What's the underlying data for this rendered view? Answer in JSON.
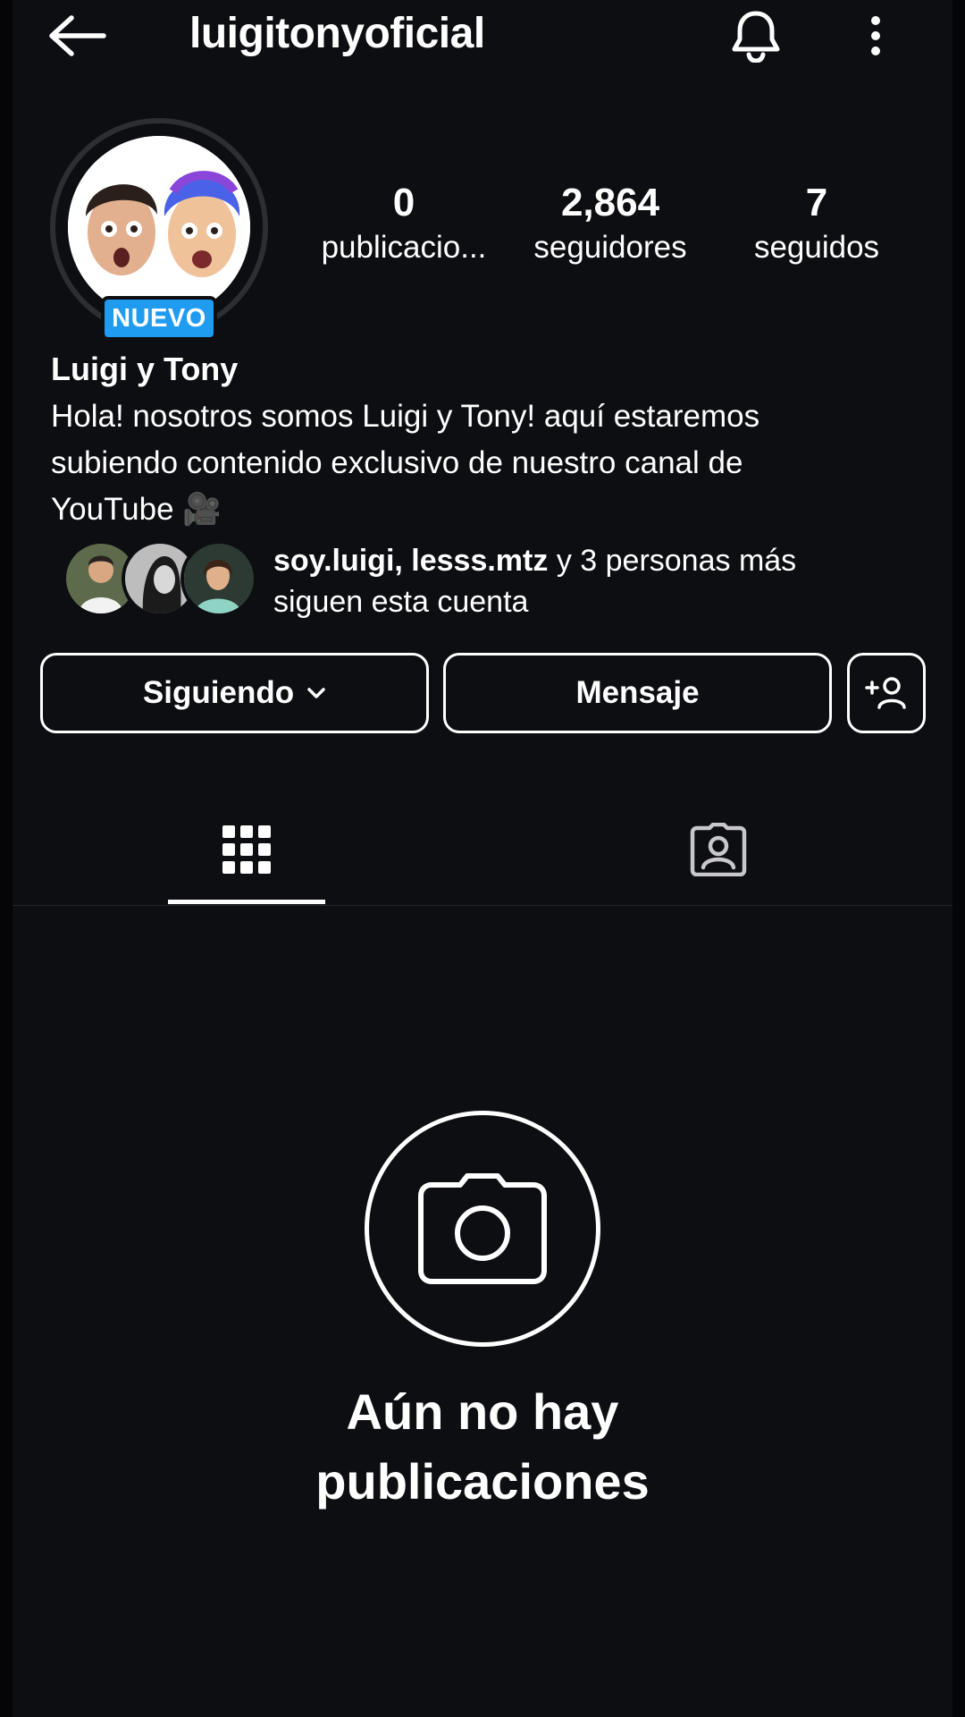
{
  "header": {
    "username": "luigitonyoficial",
    "back_icon": "arrow-left-icon",
    "notifications_icon": "bell-icon",
    "more_icon": "more-vertical-icon"
  },
  "profile": {
    "badge": "NUEVO",
    "display_name": "Luigi y Tony",
    "bio_lines": [
      "Hola! nosotros somos Luigi y Tony! aquí estaremos",
      "subiendo contenido exclusivo de nuestro canal de",
      "YouTube 🎥"
    ]
  },
  "stats": {
    "posts": {
      "value": "0",
      "label": "publicacio..."
    },
    "followers": {
      "value": "2,864",
      "label": "seguidores"
    },
    "following": {
      "value": "7",
      "label": "seguidos"
    }
  },
  "followed_by": {
    "names": "soy.luigi, lesss.mtz",
    "rest": " y 3 personas más",
    "line2": "siguen esta cuenta"
  },
  "actions": {
    "following_label": "Siguiendo",
    "message_label": "Mensaje",
    "suggest_icon": "add-person-icon"
  },
  "tabs": {
    "grid_icon": "grid-icon",
    "tagged_icon": "tagged-person-icon"
  },
  "empty_state": {
    "icon": "camera-icon",
    "line1": "Aún no hay",
    "line2": "publicaciones"
  },
  "colors": {
    "background": "#0d0e12",
    "badge": "#1f9bf0",
    "text": "#ffffff"
  }
}
